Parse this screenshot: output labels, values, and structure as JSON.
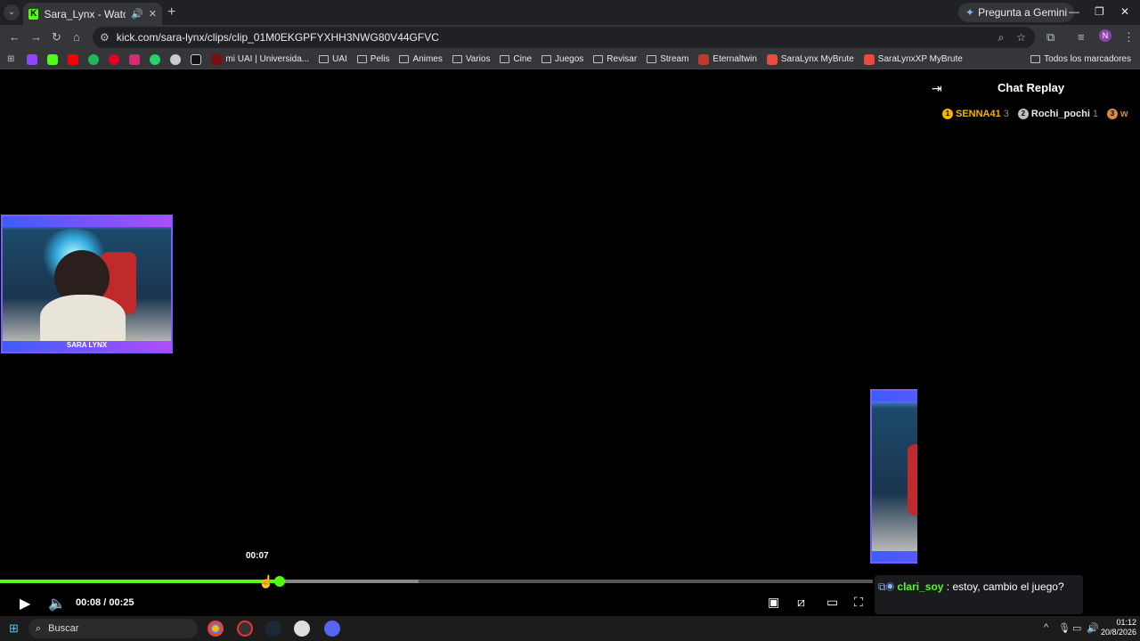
{
  "browser": {
    "tab_title": "Sara_Lynx - Watch clips on K",
    "url": "kick.com/sara-lynx/clips/clip_01M0EKGPFYXHH3NWG80V44GFVC",
    "gemini_label": "Pregunta a Gemini",
    "profile_initial": "N"
  },
  "bookmarks": [
    {
      "label": "mi UAI | Universida...",
      "type": "site"
    },
    {
      "label": "UAI",
      "type": "folder"
    },
    {
      "label": "Pelis",
      "type": "folder"
    },
    {
      "label": "Animes",
      "type": "folder"
    },
    {
      "label": "Varios",
      "type": "folder"
    },
    {
      "label": "Cine",
      "type": "folder"
    },
    {
      "label": "Juegos",
      "type": "folder"
    },
    {
      "label": "Revisar",
      "type": "folder"
    },
    {
      "label": "Stream",
      "type": "folder"
    },
    {
      "label": "Eternaltwin",
      "type": "site"
    },
    {
      "label": "SaraLynx MyBrute",
      "type": "site"
    },
    {
      "label": "SaraLynxXP MyBrute",
      "type": "site"
    }
  ],
  "bookmarks_all": "Todos los marcadores",
  "player": {
    "hover_time": "00:07",
    "current_time": "00:08",
    "separator": "/",
    "duration": "00:25",
    "progress_fraction": 0.32,
    "buffered_fraction": 0.48,
    "overlay_text": "SARA LYNX",
    "accent": "#53fc18"
  },
  "chat": {
    "title": "Chat Replay",
    "leaders": [
      {
        "name": "SENNA41",
        "count": "3",
        "color": "#f5b400",
        "rank": "1"
      },
      {
        "name": "Rochi_pochi",
        "count": "1",
        "color": "#c0c0c0",
        "rank": "2"
      },
      {
        "name": "w",
        "count": "",
        "color": "#d98b3a",
        "rank": "3"
      }
    ],
    "message": {
      "user": "clari_soy",
      "text": ": estoy, cambio el juego?"
    }
  },
  "taskbar": {
    "search_label": "Buscar",
    "time": "01:12",
    "date": "20/8/2026"
  }
}
